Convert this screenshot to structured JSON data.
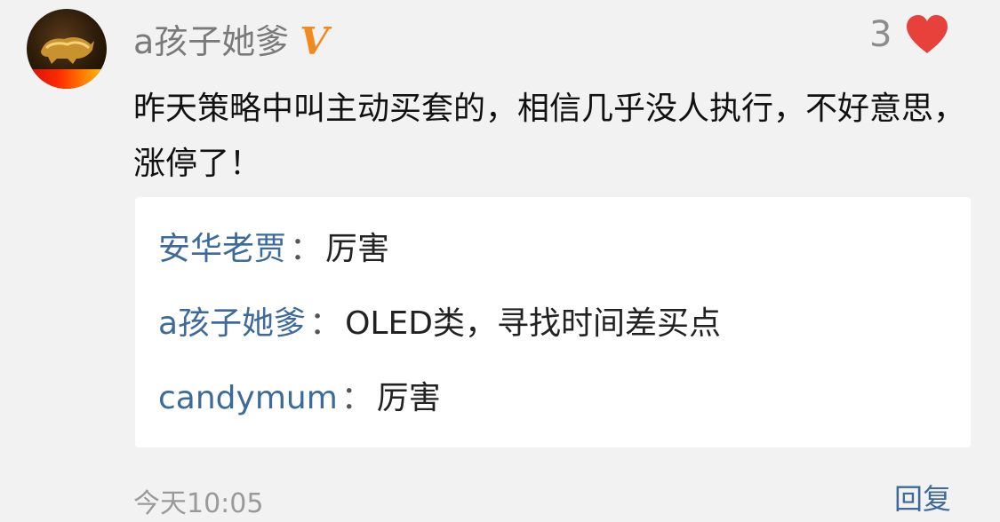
{
  "comment": {
    "avatar_icon": "golden-bull-avatar",
    "username": "a孩子她爹",
    "badge_label": "V",
    "badge_color": "#f08a1e",
    "like_count": "3",
    "like_icon": "heart-icon",
    "like_color": "#e8403a",
    "text": "昨天策略中叫主动买套的，相信几乎没人执行，不好意思，涨停了！",
    "timestamp": "今天10:05",
    "reply_label": "回复"
  },
  "replies": [
    {
      "name": "安华老贾",
      "separator": "：",
      "text": "厉害"
    },
    {
      "name": "a孩子她爹",
      "separator": "：",
      "text": "OLED类，寻找时间差买点"
    },
    {
      "name": "candymum",
      "separator": "：",
      "text": "厉害"
    }
  ],
  "colors": {
    "link_blue": "#3d6a9a",
    "background": "#f2f2f2"
  }
}
